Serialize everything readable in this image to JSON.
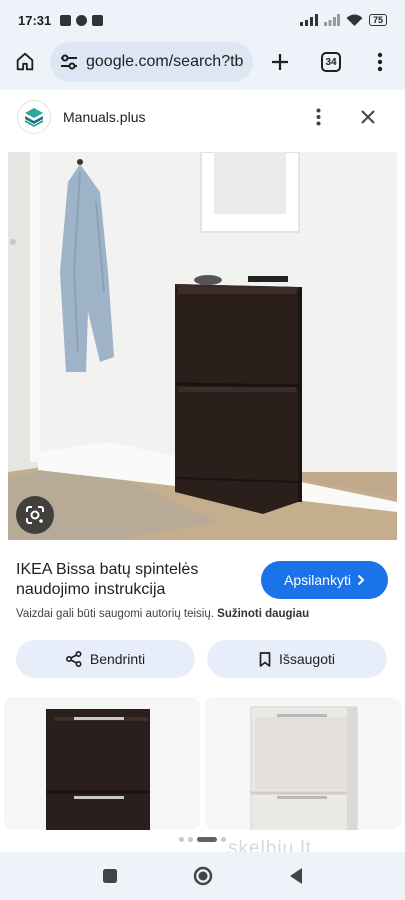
{
  "status_bar": {
    "time": "17:31",
    "battery": "75"
  },
  "browser": {
    "url": "google.com/search?tb",
    "tab_count": "34"
  },
  "source": {
    "name": "Manuals.plus"
  },
  "result": {
    "title": "IKEA Bissa batų spintelės naudojimo instrukcija",
    "visit_label": "Apsilankyti",
    "disclaimer": "Vaizdai gali būti saugomi autorių teisių.",
    "learn_more": "Sužinoti daugiau",
    "share_label": "Bendrinti",
    "save_label": "Išsaugoti"
  },
  "watermark": "skelbiu.lt",
  "colors": {
    "accent": "#1a73e8",
    "chrome_bg": "#eef2f9",
    "pill_bg": "#e8eef9",
    "cabinet_dark": "#2b1f1c"
  },
  "icons": [
    "home-icon",
    "tune-icon",
    "plus-icon",
    "more-vert-icon",
    "close-icon",
    "google-lens-icon",
    "share-icon",
    "bookmark-icon",
    "chevron-right-icon",
    "nav-square-icon",
    "nav-circle-icon",
    "nav-back-icon"
  ]
}
